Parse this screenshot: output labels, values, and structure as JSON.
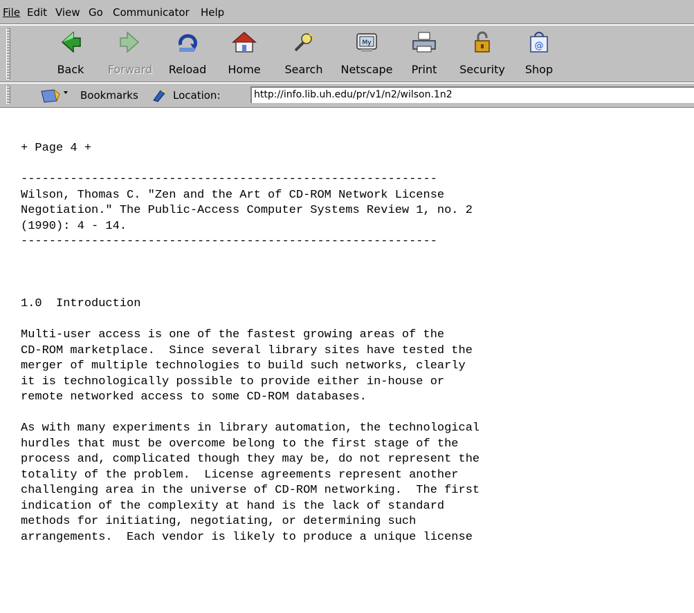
{
  "menu": [
    {
      "label": "File"
    },
    {
      "label": "Edit"
    },
    {
      "label": "View"
    },
    {
      "label": "Go"
    },
    {
      "label": "Communicator"
    },
    {
      "label": "Help"
    }
  ],
  "toolbar": {
    "buttons": [
      {
        "label": "Back",
        "icon": "back-arrow-icon",
        "enabled": true
      },
      {
        "label": "Forward",
        "icon": "forward-arrow-icon",
        "enabled": false
      },
      {
        "label": "Reload",
        "icon": "reload-icon",
        "enabled": true
      },
      {
        "label": "Home",
        "icon": "home-icon",
        "enabled": true
      },
      {
        "label": "Search",
        "icon": "search-icon",
        "enabled": true
      },
      {
        "label": "Netscape",
        "icon": "netscape-icon",
        "enabled": true
      },
      {
        "label": "Print",
        "icon": "printer-icon",
        "enabled": true
      },
      {
        "label": "Security",
        "icon": "security-lock-icon",
        "enabled": true
      },
      {
        "label": "Shop",
        "icon": "shop-bag-icon",
        "enabled": true
      }
    ]
  },
  "location_bar": {
    "bookmarks_label": "Bookmarks",
    "location_label": "Location:",
    "url": "http://info.lib.uh.edu/pr/v1/n2/wilson.1n2"
  },
  "document": {
    "page_marker": "+ Page 4 +",
    "rule": "-----------------------------------------------------------",
    "citation": [
      "Wilson, Thomas C. \"Zen and the Art of CD-ROM Network License",
      "Negotiation.\" The Public-Access Computer Systems Review 1, no. 2",
      "(1990): 4 - 14."
    ],
    "section_heading": "1.0  Introduction",
    "paragraphs": [
      [
        "Multi-user access is one of the fastest growing areas of the",
        "CD-ROM marketplace.  Since several library sites have tested the",
        "merger of multiple technologies to build such networks, clearly",
        "it is technologically possible to provide either in-house or",
        "remote networked access to some CD-ROM databases."
      ],
      [
        "As with many experiments in library automation, the technological",
        "hurdles that must be overcome belong to the first stage of the",
        "process and, complicated though they may be, do not represent the",
        "totality of the problem.  License agreements represent another",
        "challenging area in the universe of CD-ROM networking.  The first",
        "indication of the complexity at hand is the lack of standard",
        "methods for initiating, negotiating, or determining such",
        "arrangements.  Each vendor is likely to produce a unique license"
      ]
    ]
  }
}
